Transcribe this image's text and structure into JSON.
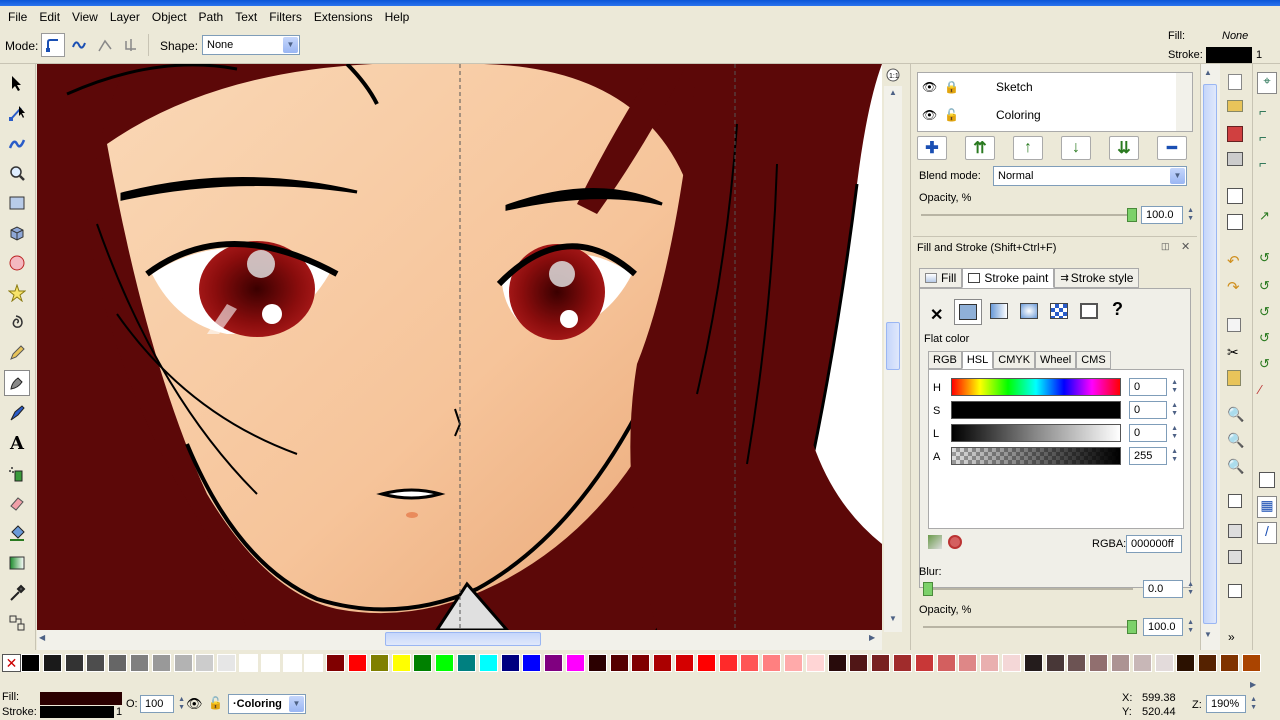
{
  "menu": [
    "File",
    "Edit",
    "View",
    "Layer",
    "Object",
    "Path",
    "Text",
    "Filters",
    "Extensions",
    "Help"
  ],
  "toolcontrols": {
    "mode_label": "Mode:",
    "shape_label": "Shape:",
    "shape_value": "None"
  },
  "top_indicator": {
    "fill_label": "Fill:",
    "fill_value": "None",
    "stroke_label": "Stroke:",
    "stroke_width": "1"
  },
  "layers": {
    "rows": [
      {
        "name": "Sketch"
      },
      {
        "name": "Coloring"
      }
    ],
    "blend_label": "Blend mode:",
    "blend_value": "Normal",
    "opacity_label": "Opacity, %",
    "opacity_value": "100.0"
  },
  "fillstroke": {
    "title": "Fill and Stroke (Shift+Ctrl+F)",
    "tabs": [
      "Fill",
      "Stroke paint",
      "Stroke style"
    ],
    "active_tab": "Stroke paint",
    "paint_type": "Flat color",
    "color_tabs": [
      "RGB",
      "HSL",
      "CMYK",
      "Wheel",
      "CMS"
    ],
    "active_color_tab": "HSL",
    "channels": [
      {
        "label": "H",
        "value": "0"
      },
      {
        "label": "S",
        "value": "0"
      },
      {
        "label": "L",
        "value": "0"
      },
      {
        "label": "A",
        "value": "255"
      }
    ],
    "rgba_label": "RGBA:",
    "rgba_value": "000000ff",
    "blur_label": "Blur:",
    "blur_value": "0.0",
    "opacity_label": "Opacity, %",
    "opacity_value": "100.0"
  },
  "status": {
    "fill_label": "Fill:",
    "stroke_label": "Stroke:",
    "stroke_width": "1",
    "opacity_label": "O:",
    "opacity_value": "100",
    "layer_value": "·Coloring",
    "x_label": "X:",
    "x_value": "599.38",
    "y_label": "Y:",
    "y_value": "520.44",
    "zoom_label": "Z:",
    "zoom_value": "190%"
  },
  "palette": [
    "#000000",
    "#1a1a1a",
    "#333333",
    "#4d4d4d",
    "#666666",
    "#808080",
    "#999999",
    "#b3b3b3",
    "#cccccc",
    "#e6e6e6",
    "#ffffff",
    "#ffffff",
    "#ffffff",
    "#ffffff",
    "#800000",
    "#ff0000",
    "#808000",
    "#ffff00",
    "#008000",
    "#00ff00",
    "#008080",
    "#00ffff",
    "#000080",
    "#0000ff",
    "#800080",
    "#ff00ff",
    "#2b0000",
    "#550000",
    "#800000",
    "#aa0000",
    "#d40000",
    "#ff0000",
    "#ff2a2a",
    "#ff5555",
    "#ff8080",
    "#ffaaaa",
    "#ffd5d5",
    "#280b0b",
    "#501616",
    "#782121",
    "#a02c2c",
    "#c83737",
    "#d35f5f",
    "#de8787",
    "#e9afaf",
    "#f4d7d7",
    "#241c1c",
    "#483737",
    "#6c5353",
    "#916f6f",
    "#ac9393",
    "#c8b7b7",
    "#e3dbdb",
    "#2b1100",
    "#552200",
    "#803300",
    "#aa4400"
  ]
}
